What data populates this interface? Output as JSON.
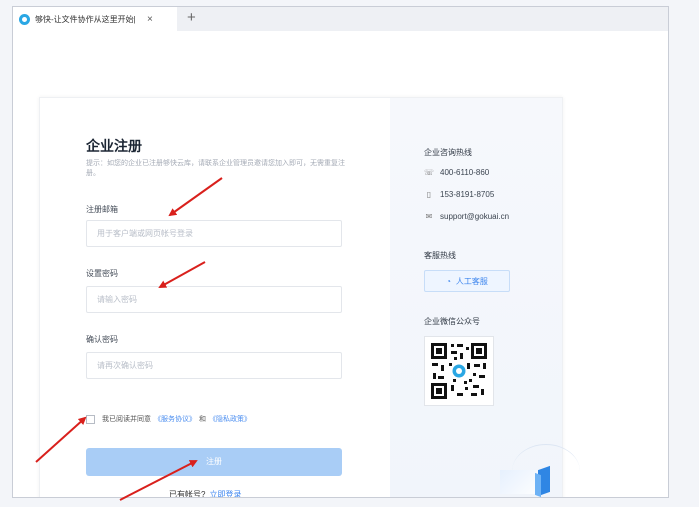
{
  "browser": {
    "tab_title": "够快-让文件协作从这里开始|",
    "tab_close": "×",
    "new_tab": "+"
  },
  "form": {
    "title": "企业注册",
    "hint": "提示：如您的企业已注册够快云库，请联系企业管理员邀请您加入即可，无需重复注册。",
    "email_label": "注册邮箱",
    "email_placeholder": "用于客户端或网页帐号登录",
    "password_label": "设置密码",
    "password_placeholder": "请输入密码",
    "confirm_label": "确认密码",
    "confirm_placeholder": "请再次确认密码",
    "agree_text": "我已阅读并同意",
    "terms_link": "《服务协议》",
    "and_text": "和",
    "privacy_link": "《隐私政策》",
    "register_button": "注册",
    "have_account_text": "已有帐号?",
    "login_link": "立即登录"
  },
  "contact": {
    "hotline_title": "企业咨询热线",
    "phone1": "400-6110-860",
    "phone2": "153-8191-8705",
    "email": "support@gokuai.cn",
    "service_title": "客服热线",
    "service_button": "人工客服",
    "wechat_title": "企业微信公众号"
  },
  "icons": {
    "phone": "phone-icon",
    "mobile": "mobile-icon",
    "mail": "mail-icon",
    "headset": "headset-icon"
  },
  "colors": {
    "accent": "#3d86f0",
    "button_disabled": "#a9cdf6",
    "annotation": "#d9201c"
  }
}
